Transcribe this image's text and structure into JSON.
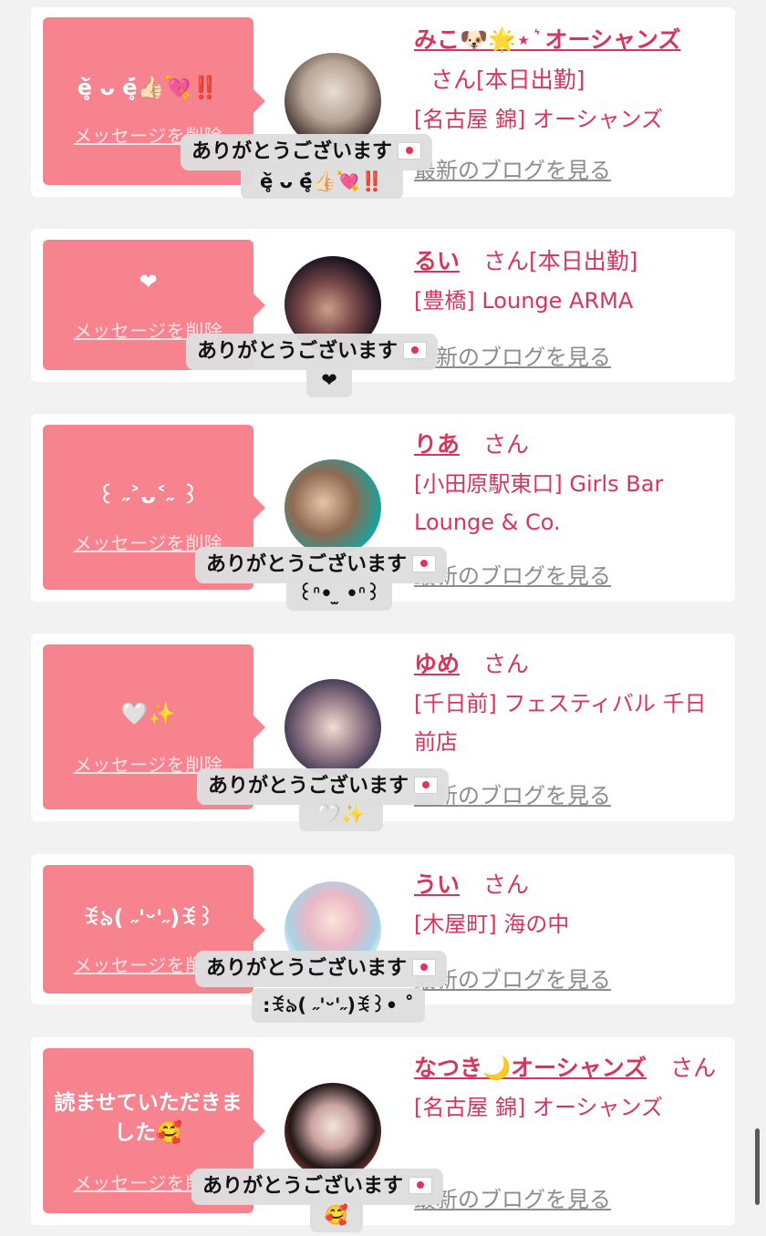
{
  "delete_label": "メッセージを削除",
  "blog_label": "最新のブログを見る",
  "san_label": "さん",
  "thanks_label": "ありがとうございます",
  "cards": [
    {
      "bubble_msg": "è̥̆ ᴗ é̥̆👍🏻💘‼️",
      "name": "みこ🐶🌟⋆ ͛ オーシャンズ",
      "status": "[本日出勤]",
      "shop": "[名古屋 錦] オーシャンズ",
      "avatar_icon": "avatar-photo-icon",
      "popup_sub": "è̥̆ ᴗ é̥̆👍🏻💘‼️"
    },
    {
      "bubble_msg": "❤",
      "name": "るい",
      "status": "[本日出勤]",
      "shop": "[豊橋] Lounge ARMA",
      "avatar_icon": "avatar-photo-icon",
      "popup_sub": "❤"
    },
    {
      "bubble_msg": "꒰ ˶˃ᴗ˂˶ ꒱",
      "name": "りあ",
      "status": "",
      "shop": "[小田原駅東口] Girls Bar Lounge & Co.",
      "avatar_icon": "avatar-photo-icon",
      "popup_sub": "꒰ᐢ• ̫ •ᐢ꒱"
    },
    {
      "bubble_msg": "🤍✨",
      "name": "ゆめ",
      "status": "",
      "shop": "[千日前] フェスティバル 千日前店",
      "avatar_icon": "avatar-photo-icon",
      "popup_sub": "🤍✨"
    },
    {
      "bubble_msg": "ꉂ৯( ˶'ᵕ'˶)ꉂ꒱",
      "name": "うい",
      "status": "",
      "shop": "[木屋町] 海の中",
      "avatar_icon": "avatar-photo-icon",
      "popup_sub": ":ꉂ৯( ˶'ᵕ'˶)ꉂ꒱• ˚"
    },
    {
      "bubble_msg": "読ませていただきました🥰",
      "name": "なつき🌙オーシャンズ",
      "status": "",
      "shop": "[名古屋 錦] オーシャンズ",
      "avatar_icon": "avatar-photo-icon",
      "popup_sub": "🥰"
    }
  ],
  "colors": {
    "bubble": "#f7838f",
    "accent": "#d8355d",
    "link_gray": "#8c8c8c",
    "background": "#f2f2f2",
    "popup": "#dedede"
  }
}
